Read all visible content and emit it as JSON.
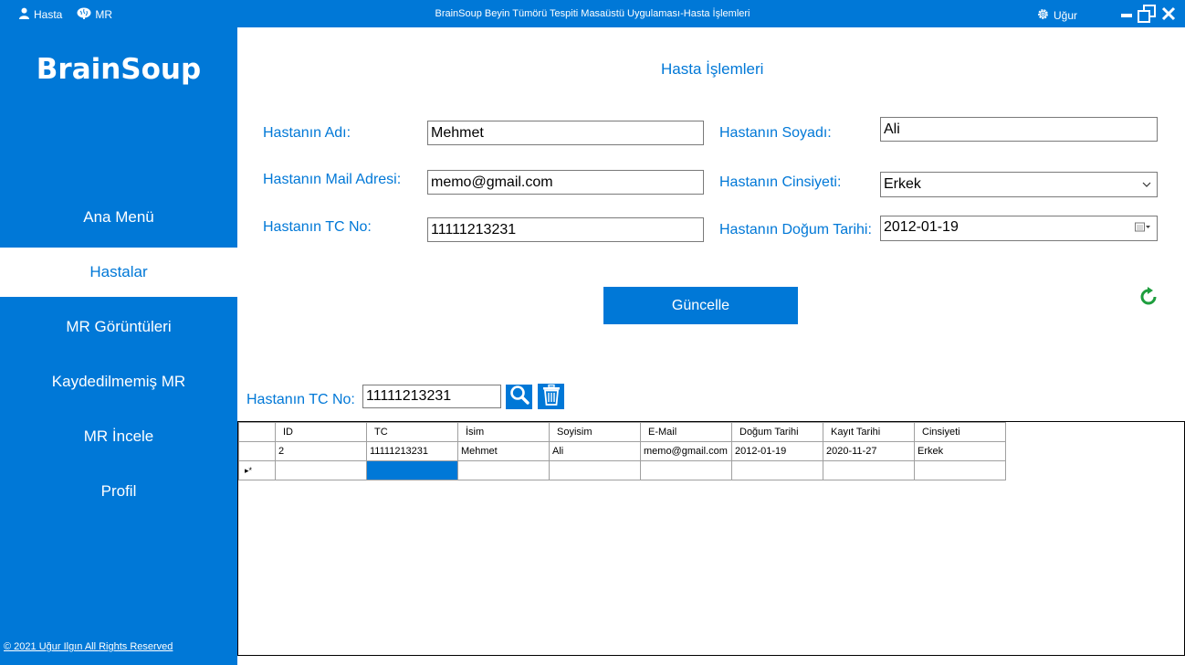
{
  "titlebar": {
    "patients_label": "Hasta",
    "mr_label": "MR",
    "title": "BrainSoup Beyin Tümörü Tespiti Masaüstü Uygulaması-Hasta İşlemleri",
    "user_label": "Uğur"
  },
  "sidebar": {
    "logo": "BrainSoup",
    "items": [
      {
        "label": "Ana Menü",
        "active": false
      },
      {
        "label": "Hastalar",
        "active": true
      },
      {
        "label": "MR Görüntüleri",
        "active": false
      },
      {
        "label": "Kaydedilmemiş MR",
        "active": false
      },
      {
        "label": "MR İncele",
        "active": false
      },
      {
        "label": "Profil",
        "active": false
      }
    ],
    "copyright": "© 2021 Uğur Ilgın All Rights Reserved"
  },
  "form": {
    "heading": "Hasta İşlemleri",
    "name_label": "Hastanın Adı:",
    "name_value": "Mehmet",
    "surname_label": "Hastanın Soyadı:",
    "surname_value": "Ali",
    "mail_label": "Hastanın Mail Adresi:",
    "mail_value": "memo@gmail.com",
    "gender_label": "Hastanın Cinsiyeti:",
    "gender_value": "Erkek",
    "tc_label": "Hastanın TC No:",
    "tc_value": "11111213231",
    "birth_label": "Hastanın Doğum Tarihi:",
    "birth_value": "2012-01-19",
    "update_button": "Güncelle"
  },
  "search": {
    "tc_label": "Hastanın TC No:",
    "tc_value": "11111213231"
  },
  "grid": {
    "columns": [
      "ID",
      "TC",
      "İsim",
      "Soyisim",
      "E-Mail",
      "Doğum Tarihi",
      "Kayıt Tarihi",
      "Cinsiyeti"
    ],
    "rows": [
      [
        "2",
        "11111213231",
        "Mehmet",
        "Ali",
        "memo@gmail.com",
        "2012-01-19",
        "2020-11-27",
        "Erkek"
      ]
    ],
    "new_row_marker": "▸*"
  },
  "colors": {
    "accent": "#0078D7",
    "refresh": "#1E9E3E"
  }
}
